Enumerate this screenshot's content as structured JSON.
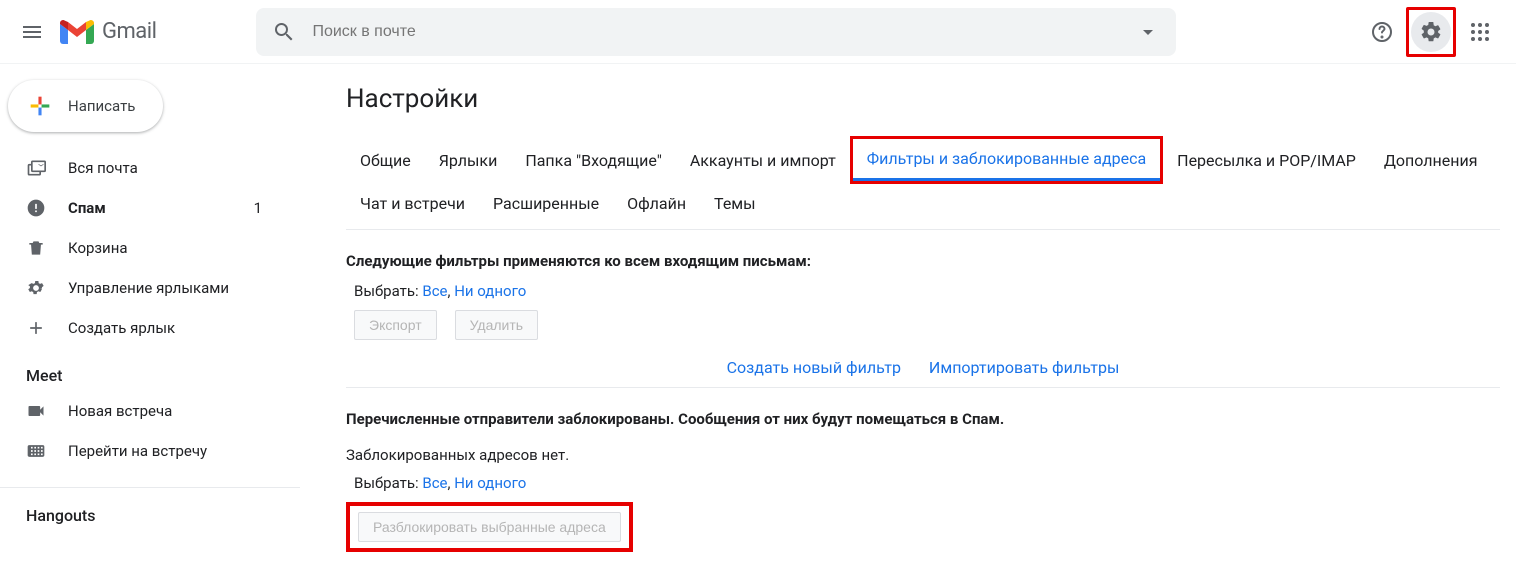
{
  "header": {
    "logo_text": "Gmail",
    "search_placeholder": "Поиск в почте"
  },
  "compose_label": "Написать",
  "sidebar": {
    "items": [
      {
        "label": "Вся почта",
        "count": "",
        "bold": false,
        "icon": "stack"
      },
      {
        "label": "Спам",
        "count": "1",
        "bold": true,
        "icon": "warn"
      },
      {
        "label": "Корзина",
        "count": "",
        "bold": false,
        "icon": "trash"
      },
      {
        "label": "Управление ярлыками",
        "count": "",
        "bold": false,
        "icon": "gear"
      },
      {
        "label": "Создать ярлык",
        "count": "",
        "bold": false,
        "icon": "plus"
      }
    ],
    "meet_title": "Meet",
    "meet_items": [
      {
        "label": "Новая встреча",
        "icon": "video"
      },
      {
        "label": "Перейти на встречу",
        "icon": "keyboard"
      }
    ],
    "hangouts_title": "Hangouts"
  },
  "main": {
    "title": "Настройки",
    "tabs": [
      "Общие",
      "Ярлыки",
      "Папка \"Входящие\"",
      "Аккаунты и импорт",
      "Фильтры и заблокированные адреса",
      "Пересылка и POP/IMAP",
      "Дополнения",
      "Чат и встречи",
      "Расширенные",
      "Офлайн",
      "Темы"
    ],
    "filters_heading": "Следующие фильтры применяются ко всем входящим письмам:",
    "select_label": "Выбрать:",
    "select_all": "Все",
    "select_none": "Ни одного",
    "export_btn": "Экспорт",
    "delete_btn": "Удалить",
    "create_filter": "Создать новый фильтр",
    "import_filters": "Импортировать фильтры",
    "blocked_heading": "Перечисленные отправители заблокированы. Сообщения от них будут помещаться в Спам.",
    "no_blocked": "Заблокированных адресов нет.",
    "unblock_btn": "Разблокировать выбранные адреса"
  }
}
